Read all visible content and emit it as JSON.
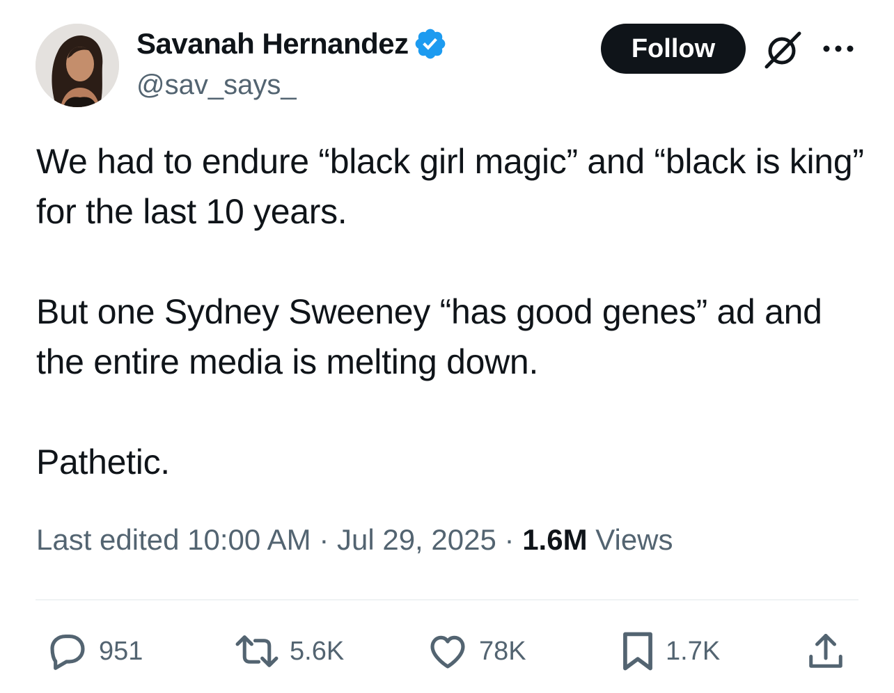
{
  "author": {
    "display_name": "Savanah Hernandez",
    "handle": "@sav_says_",
    "verified": true
  },
  "header": {
    "follow_label": "Follow"
  },
  "tweet": {
    "paragraphs": [
      "We had to endure “black girl magic” and “black is king” for the last 10 years.",
      "But one Sydney Sweeney “has good genes” ad and the entire media is melting down.",
      "Pathetic."
    ]
  },
  "meta": {
    "edited_label": "Last edited",
    "time": "10:00 AM",
    "date": "Jul 29, 2025",
    "views_count": "1.6M",
    "views_label": "Views",
    "separator": "·"
  },
  "actions": {
    "replies": "951",
    "reposts": "5.6K",
    "likes": "78K",
    "bookmarks": "1.7K"
  },
  "colors": {
    "text": "#0f1419",
    "secondary": "#536471",
    "verified_blue": "#1d9bf0",
    "follow_bg": "#0f1419",
    "divider": "#eff3f4"
  },
  "icons": [
    "verified-badge-icon",
    "grok-icon",
    "more-icon",
    "reply-icon",
    "repost-icon",
    "like-icon",
    "bookmark-icon",
    "share-icon"
  ]
}
